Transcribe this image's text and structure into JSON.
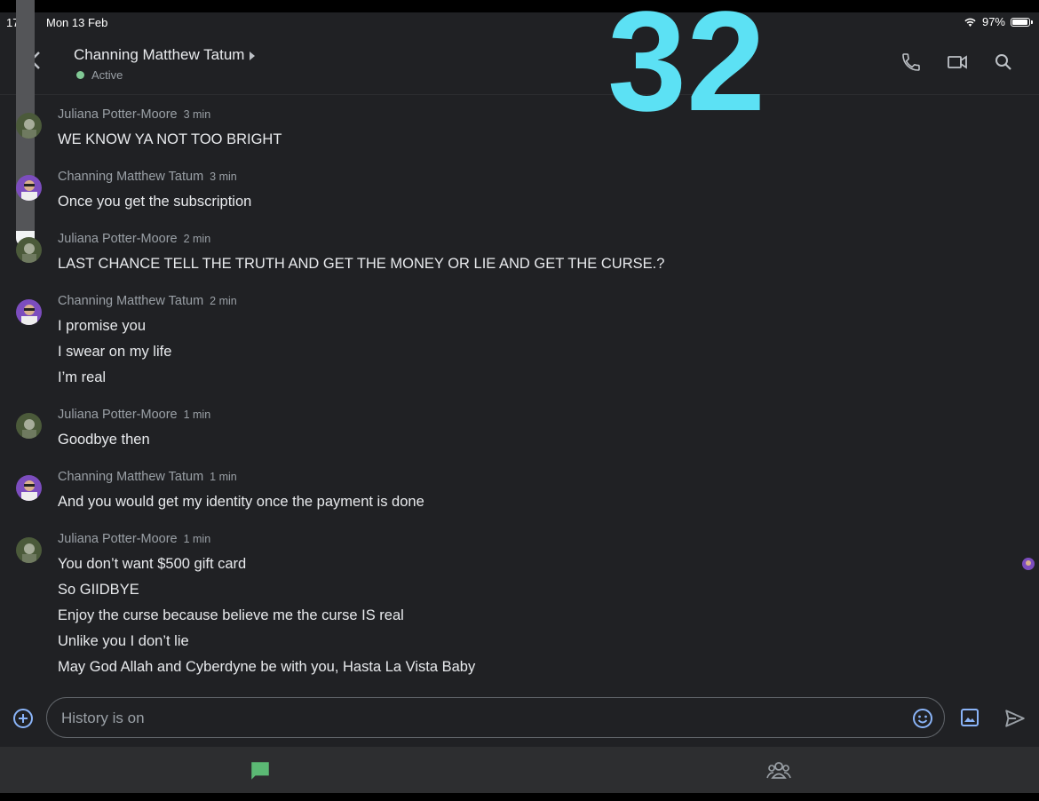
{
  "status_bar": {
    "time": "17",
    "date": "Mon 13 Feb",
    "battery": "97%",
    "battery_level": 0.97
  },
  "header": {
    "name": "Channing Matthew Tatum",
    "presence": "Active"
  },
  "overlay_text": "32",
  "messages": [
    {
      "sender": "Juliana Potter-Moore",
      "time": "3 min",
      "lines": [
        "WE KNOW YA NOT TOO BRIGHT"
      ]
    },
    {
      "sender": "Channing Matthew Tatum",
      "time": "3 min",
      "lines": [
        "Once you get the subscription"
      ]
    },
    {
      "sender": "Juliana Potter-Moore",
      "time": "2 min",
      "lines": [
        "LAST CHANCE TELL THE TRUTH AND GET THE MONEY OR LIE AND GET THE CURSE.?"
      ]
    },
    {
      "sender": "Channing Matthew Tatum",
      "time": "2 min",
      "lines": [
        "I promise you",
        "I swear on my life",
        "I’m real"
      ]
    },
    {
      "sender": "Juliana Potter-Moore",
      "time": "1 min",
      "lines": [
        "Goodbye then"
      ]
    },
    {
      "sender": "Channing Matthew Tatum",
      "time": "1 min",
      "lines": [
        "And you would get my identity once the payment is done"
      ]
    },
    {
      "sender": "Juliana Potter-Moore",
      "time": "1 min",
      "lines": [
        "You don’t want $500 gift card",
        "So GIIDBYE",
        "Enjoy the curse because believe me the curse IS real",
        "Unlike you I don’t lie",
        "May God Allah and Cyberdyne be with you, Hasta La Vista Baby"
      ]
    }
  ],
  "composer": {
    "placeholder": "History is on"
  },
  "colors": {
    "background": "#202124",
    "accent": "#8ab4f8",
    "active_green": "#81c995",
    "chat_nav_green": "#5bb974",
    "overlay_cyan": "#5ce1f4"
  },
  "icons": [
    "back-icon",
    "phone-icon",
    "video-icon",
    "search-icon",
    "add-icon",
    "emoji-icon",
    "image-icon",
    "send-icon",
    "chat-icon",
    "people-icon"
  ]
}
